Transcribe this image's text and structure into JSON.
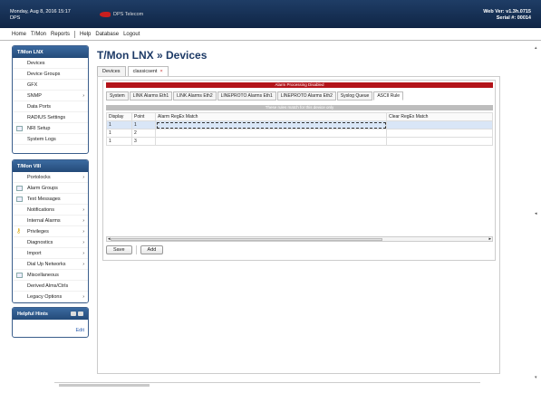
{
  "header": {
    "datetime": "Monday, Aug 8, 2016 15:17",
    "site": "DPS",
    "logo_text": "DPS Telecom",
    "web_ver": "Web Ver: v1.3h.0715",
    "serial": "Serial #: 00014"
  },
  "menu": [
    "Home",
    "T/Mon",
    "Reports",
    "Help",
    "Database",
    "Logout"
  ],
  "sidebar1": {
    "title": "T/Mon LNX",
    "items": [
      {
        "label": "Devices"
      },
      {
        "label": "Device Groups"
      },
      {
        "label": "GFX"
      },
      {
        "label": "SNMP",
        "arrow": "›"
      },
      {
        "label": "Data Ports"
      },
      {
        "label": "RADIUS Settings"
      },
      {
        "label": "NRI Setup"
      },
      {
        "label": "System Logs"
      }
    ]
  },
  "sidebar2": {
    "title": "T/Mon VIII",
    "items": [
      {
        "label": "Portolocks",
        "arrow": "›"
      },
      {
        "label": "Alarm Groups"
      },
      {
        "label": "Text Messages"
      },
      {
        "label": "Notifications",
        "arrow": "›"
      },
      {
        "label": "Internal Alarms",
        "arrow": "›"
      },
      {
        "label": "Privileges",
        "arrow": "›"
      },
      {
        "label": "Diagnostics",
        "arrow": "›"
      },
      {
        "label": "Import",
        "arrow": "›"
      },
      {
        "label": "Dial Up Networks",
        "arrow": "›"
      },
      {
        "label": "Miscellaneous"
      },
      {
        "label": "Derived Alms/Ctrls"
      },
      {
        "label": "Legacy Options",
        "arrow": "›"
      }
    ]
  },
  "sidebar3": {
    "title": "Helpful Hints",
    "edit": "Edit"
  },
  "page": {
    "title": "T/Mon LNX » Devices"
  },
  "tabs": [
    {
      "label": "Devices"
    },
    {
      "label": "classicsent",
      "close": "×"
    }
  ],
  "alert": "Alarm Processing Disabled",
  "subtabs": [
    "System",
    "LINK Alarms Eth1",
    "LINK Alarms Eth2",
    "LINEPROTO Alarms Eth1",
    "LINEPROTO Alarms Eth2",
    "Syslog Queue",
    "ASCII Rule"
  ],
  "notice": "These rules match for this device only",
  "table": {
    "headers": [
      "Display",
      "Point",
      "Alarm RegEx Match",
      "Clear RegEx Match"
    ],
    "rows": [
      [
        "1",
        "1",
        "",
        ""
      ],
      [
        "1",
        "2",
        "",
        ""
      ],
      [
        "1",
        "3",
        "",
        ""
      ]
    ]
  },
  "buttons": {
    "save": "Save",
    "add": "Add"
  },
  "scroll": {
    "left": "◂",
    "right": "▸",
    "up": "▴",
    "down": "▾",
    "mid": "◂"
  }
}
